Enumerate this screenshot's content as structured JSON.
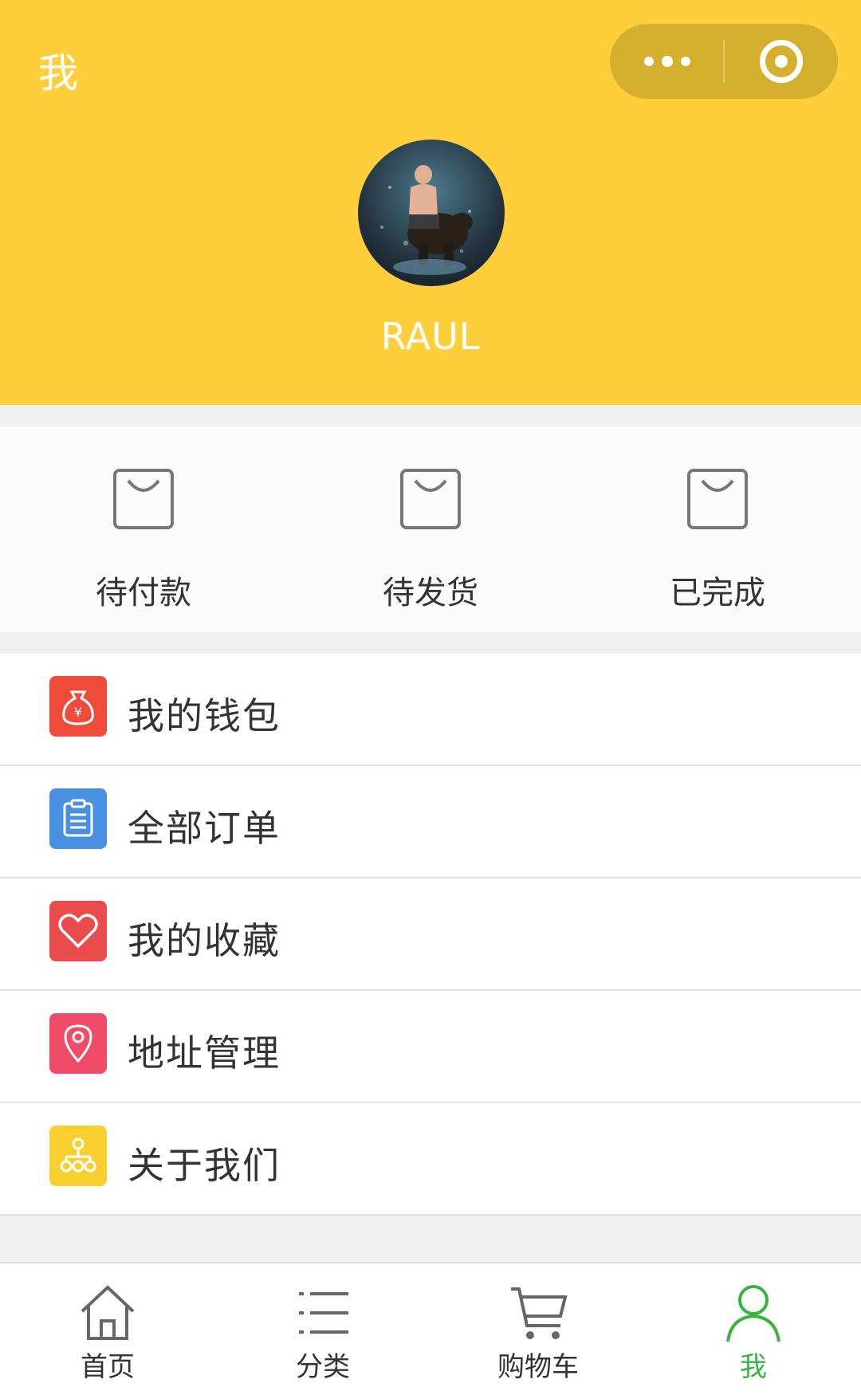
{
  "header": {
    "title": "我",
    "more_icon": "more-dots-icon",
    "close_icon": "target-close-icon",
    "background_color": "#fecf3a"
  },
  "profile": {
    "username": "RAUL",
    "avatar": "user-avatar-photo"
  },
  "orders": [
    {
      "label": "待付款",
      "icon": "shopping-bag-icon"
    },
    {
      "label": "待发货",
      "icon": "shopping-bag-icon"
    },
    {
      "label": "已完成",
      "icon": "shopping-bag-icon"
    }
  ],
  "menu": [
    {
      "label": "我的钱包",
      "icon": "money-bag-icon",
      "color": "#ef4b3a"
    },
    {
      "label": "全部订单",
      "icon": "clipboard-icon",
      "color": "#4a90e2"
    },
    {
      "label": "我的收藏",
      "icon": "heart-icon",
      "color": "#ea4c4c"
    },
    {
      "label": "地址管理",
      "icon": "location-pin-icon",
      "color": "#ef4c6a"
    },
    {
      "label": "关于我们",
      "icon": "org-chart-icon",
      "color": "#f8cf2e"
    }
  ],
  "tabbar": {
    "active_color": "#36b53c",
    "tabs": [
      {
        "label": "首页",
        "icon": "home-icon",
        "active": false
      },
      {
        "label": "分类",
        "icon": "list-icon",
        "active": false
      },
      {
        "label": "购物车",
        "icon": "cart-icon",
        "active": false
      },
      {
        "label": "我",
        "icon": "person-icon",
        "active": true
      }
    ]
  }
}
